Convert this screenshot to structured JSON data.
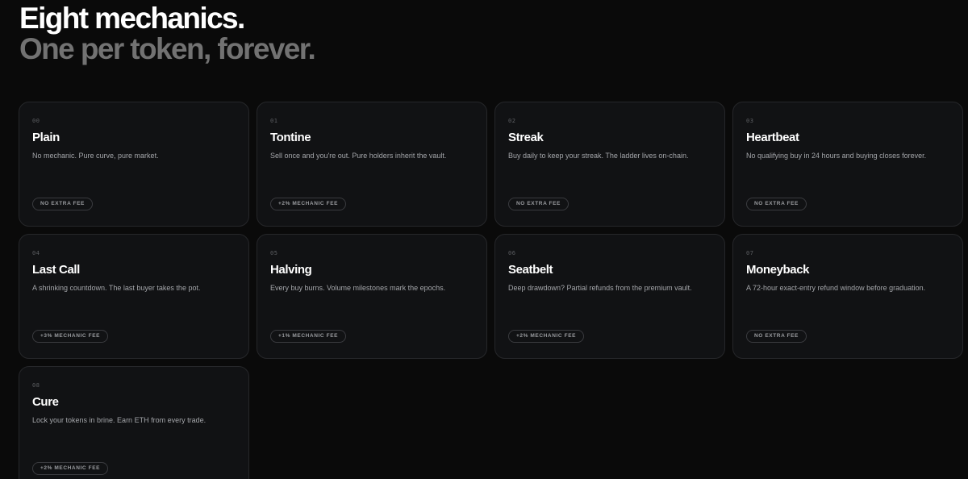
{
  "header": {
    "title_line1": "Eight mechanics.",
    "title_line2": "One per token, forever."
  },
  "mechanics": [
    {
      "num": "00",
      "name": "Plain",
      "desc": "No mechanic. Pure curve, pure market.",
      "fee": "NO EXTRA FEE"
    },
    {
      "num": "01",
      "name": "Tontine",
      "desc": "Sell once and you're out. Pure holders inherit the vault.",
      "fee": "+2% MECHANIC FEE"
    },
    {
      "num": "02",
      "name": "Streak",
      "desc": "Buy daily to keep your streak. The ladder lives on-chain.",
      "fee": "NO EXTRA FEE"
    },
    {
      "num": "03",
      "name": "Heartbeat",
      "desc": "No qualifying buy in 24 hours and buying closes forever.",
      "fee": "NO EXTRA FEE"
    },
    {
      "num": "04",
      "name": "Last Call",
      "desc": "A shrinking countdown. The last buyer takes the pot.",
      "fee": "+3% MECHANIC FEE"
    },
    {
      "num": "05",
      "name": "Halving",
      "desc": "Every buy burns. Volume milestones mark the epochs.",
      "fee": "+1% MECHANIC FEE"
    },
    {
      "num": "06",
      "name": "Seatbelt",
      "desc": "Deep drawdown? Partial refunds from the premium vault.",
      "fee": "+2% MECHANIC FEE"
    },
    {
      "num": "07",
      "name": "Moneyback",
      "desc": "A 72-hour exact-entry refund window before graduation.",
      "fee": "NO EXTRA FEE"
    },
    {
      "num": "08",
      "name": "Cure",
      "desc": "Lock your tokens in brine. Earn ETH from every trade.",
      "fee": "+2% MECHANIC FEE"
    }
  ]
}
